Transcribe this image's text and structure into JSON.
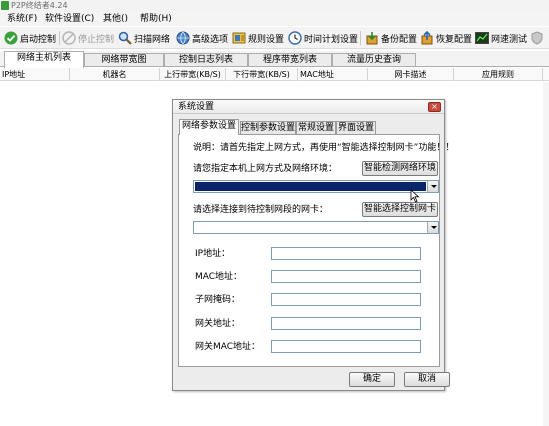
{
  "app": {
    "title": "P2P终结者4.24"
  },
  "menu": [
    {
      "label": "系统(F)"
    },
    {
      "label": "软件设置(C)"
    },
    {
      "label": "其他()"
    },
    {
      "label": "帮助(H)"
    }
  ],
  "toolbar": {
    "start": {
      "label": "启动控制",
      "icon": "check-icon"
    },
    "stop": {
      "label": "停止控制",
      "icon": "stop-icon"
    },
    "scan": {
      "label": "扫描网络",
      "icon": "magnifier-icon"
    },
    "advanced": {
      "label": "高级选项",
      "icon": "globe-icon"
    },
    "rules": {
      "label": "规则设置",
      "icon": "rules-icon"
    },
    "schedule": {
      "label": "时间计划设置",
      "icon": "clock-icon"
    },
    "backup": {
      "label": "备份配置",
      "icon": "backup-icon"
    },
    "restore": {
      "label": "恢复配置",
      "icon": "restore-icon"
    },
    "speedtest": {
      "label": "网速测试",
      "icon": "speed-chart-icon"
    }
  },
  "main_tabs": [
    {
      "label": "网络主机列表"
    },
    {
      "label": "网络带宽图"
    },
    {
      "label": "控制日志列表"
    },
    {
      "label": "程序带宽列表"
    },
    {
      "label": "流量历史查询"
    }
  ],
  "columns": [
    {
      "label": "IP地址"
    },
    {
      "label": "机器名"
    },
    {
      "label": "上行带宽(KB/S)"
    },
    {
      "label": "下行带宽(KB/S)"
    },
    {
      "label": "MAC地址"
    },
    {
      "label": "网卡描述"
    },
    {
      "label": "应用规则"
    }
  ],
  "dialog": {
    "title": "系统设置",
    "close_glyph": "×",
    "tabs": [
      {
        "label": "网络参数设置"
      },
      {
        "label": "控制参数设置"
      },
      {
        "label": "常规设置"
      },
      {
        "label": "界面设置"
      }
    ],
    "note": "说明：请首先指定上网方式，再使用“智能选择控制网卡”功能！！",
    "env_prompt": "请您指定本机上网方式及网络环境：",
    "detect_button": "智能检测网络环境",
    "nic_prompt": "请选择连接到待控制网段的网卡：",
    "select_nic_button": "智能选择控制网卡",
    "fields": [
      {
        "label": "IP地址：",
        "value": ""
      },
      {
        "label": "MAC地址：",
        "value": ""
      },
      {
        "label": "子网掩码：",
        "value": ""
      },
      {
        "label": "网关地址：",
        "value": ""
      },
      {
        "label": "网关MAC地址：",
        "value": ""
      }
    ],
    "ok_button": "确定",
    "cancel_button": "取消"
  },
  "colors": {
    "selection": "#0a246a",
    "start_icon_green": "#3aa03a",
    "close_red": "#c94a3c"
  }
}
